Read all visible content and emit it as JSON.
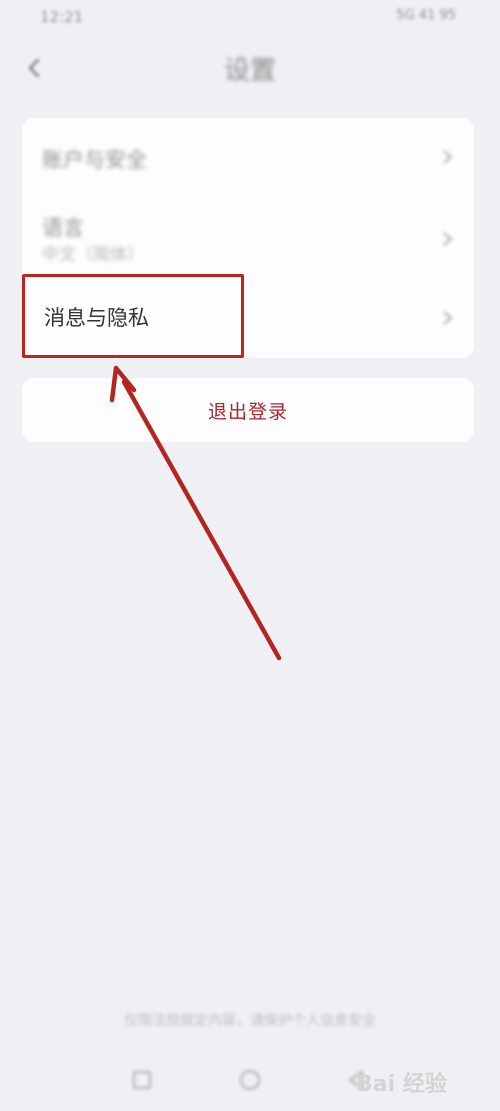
{
  "status_bar": {
    "time": "12:21",
    "right": "5G 41 95"
  },
  "header": {
    "back_icon": "chevron-left-icon",
    "title": "设置"
  },
  "settings": {
    "rows": [
      {
        "label": "账户与安全",
        "chevron": "chevron-right-icon"
      },
      {
        "label": "语言",
        "sublabel": "中文（简体）",
        "chevron": "chevron-right-icon"
      },
      {
        "label": "消息与隐私",
        "chevron": "chevron-right-icon"
      }
    ]
  },
  "logout": {
    "label": "退出登录"
  },
  "annotation": {
    "highlight_color": "#c0241c",
    "arrow_color": "#b52520"
  },
  "footer": {
    "note": "仅限法规规定内容，请保护个人信息安全"
  },
  "bottom_nav": {
    "icons": [
      "square-icon",
      "circle-icon",
      "triangle-icon"
    ]
  },
  "watermark": {
    "text": "Bai 经验"
  }
}
